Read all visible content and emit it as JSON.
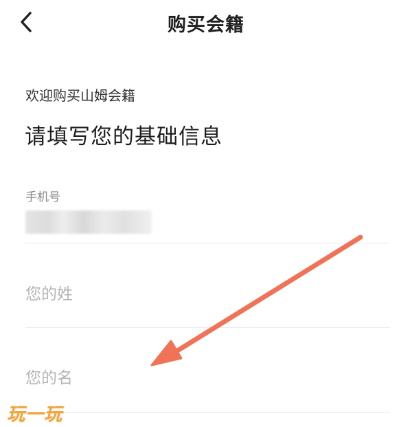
{
  "nav": {
    "title": "购买会籍",
    "back_icon": "chevron-left-icon"
  },
  "intro": {
    "welcome": "欢迎购买山姆会籍",
    "heading": "请填写您的基础信息"
  },
  "form": {
    "phone_label": "手机号",
    "phone_value_state": "blurred",
    "last_name_placeholder": "您的姓",
    "first_name_placeholder": "您的名"
  },
  "annotation": {
    "arrow_color": "#f07358",
    "arrow_icon": "arrow-down-left-icon"
  },
  "watermark": {
    "text": "玩一玩",
    "color": "#f0a23b"
  }
}
